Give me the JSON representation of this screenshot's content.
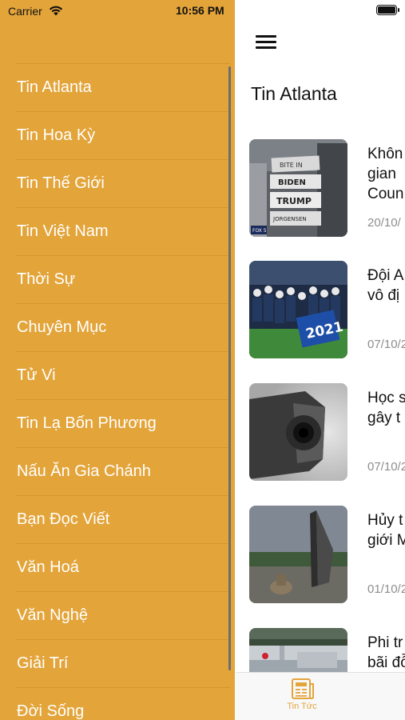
{
  "status_bar": {
    "carrier": "Carrier",
    "time": "10:56 PM"
  },
  "drawer": {
    "background_color": "#e3a43a",
    "items": [
      {
        "label": "Tin Atlanta"
      },
      {
        "label": "Tin Hoa Kỳ"
      },
      {
        "label": "Tin Thế Giới"
      },
      {
        "label": "Tin Việt Nam"
      },
      {
        "label": "Thời Sự"
      },
      {
        "label": "Chuyên Mục"
      },
      {
        "label": "Tử Vi"
      },
      {
        "label": "Tin Lạ Bốn Phương"
      },
      {
        "label": "Nấu Ăn Gia Chánh"
      },
      {
        "label": "Bạn Đọc Viết"
      },
      {
        "label": "Văn Hoá"
      },
      {
        "label": "Văn Nghệ"
      },
      {
        "label": "Giải Trí"
      },
      {
        "label": "Đời Sống"
      }
    ]
  },
  "main": {
    "title": "Tin Atlanta",
    "articles": [
      {
        "headline": "Khôn\ngian\nCoun",
        "date": "20/10/",
        "thumb_text": [
          "BITE IN",
          "BIDEN",
          "TRUMP",
          "JORGENSEN",
          "FOX 5"
        ]
      },
      {
        "headline": "Đội A\nvô đị",
        "date": "07/10/2",
        "thumb_text": [
          "2021"
        ]
      },
      {
        "headline": "Học s\ngây t",
        "date": "07/10/2"
      },
      {
        "headline": "Hủy t\ngiới M",
        "date": "01/10/2"
      },
      {
        "headline": "Phi tr\nbãi đỗ",
        "date": ""
      }
    ]
  },
  "tabbar": {
    "active_color": "#e3a43a",
    "items": [
      {
        "label": "Tin Tức",
        "icon": "newspaper-icon"
      }
    ]
  }
}
